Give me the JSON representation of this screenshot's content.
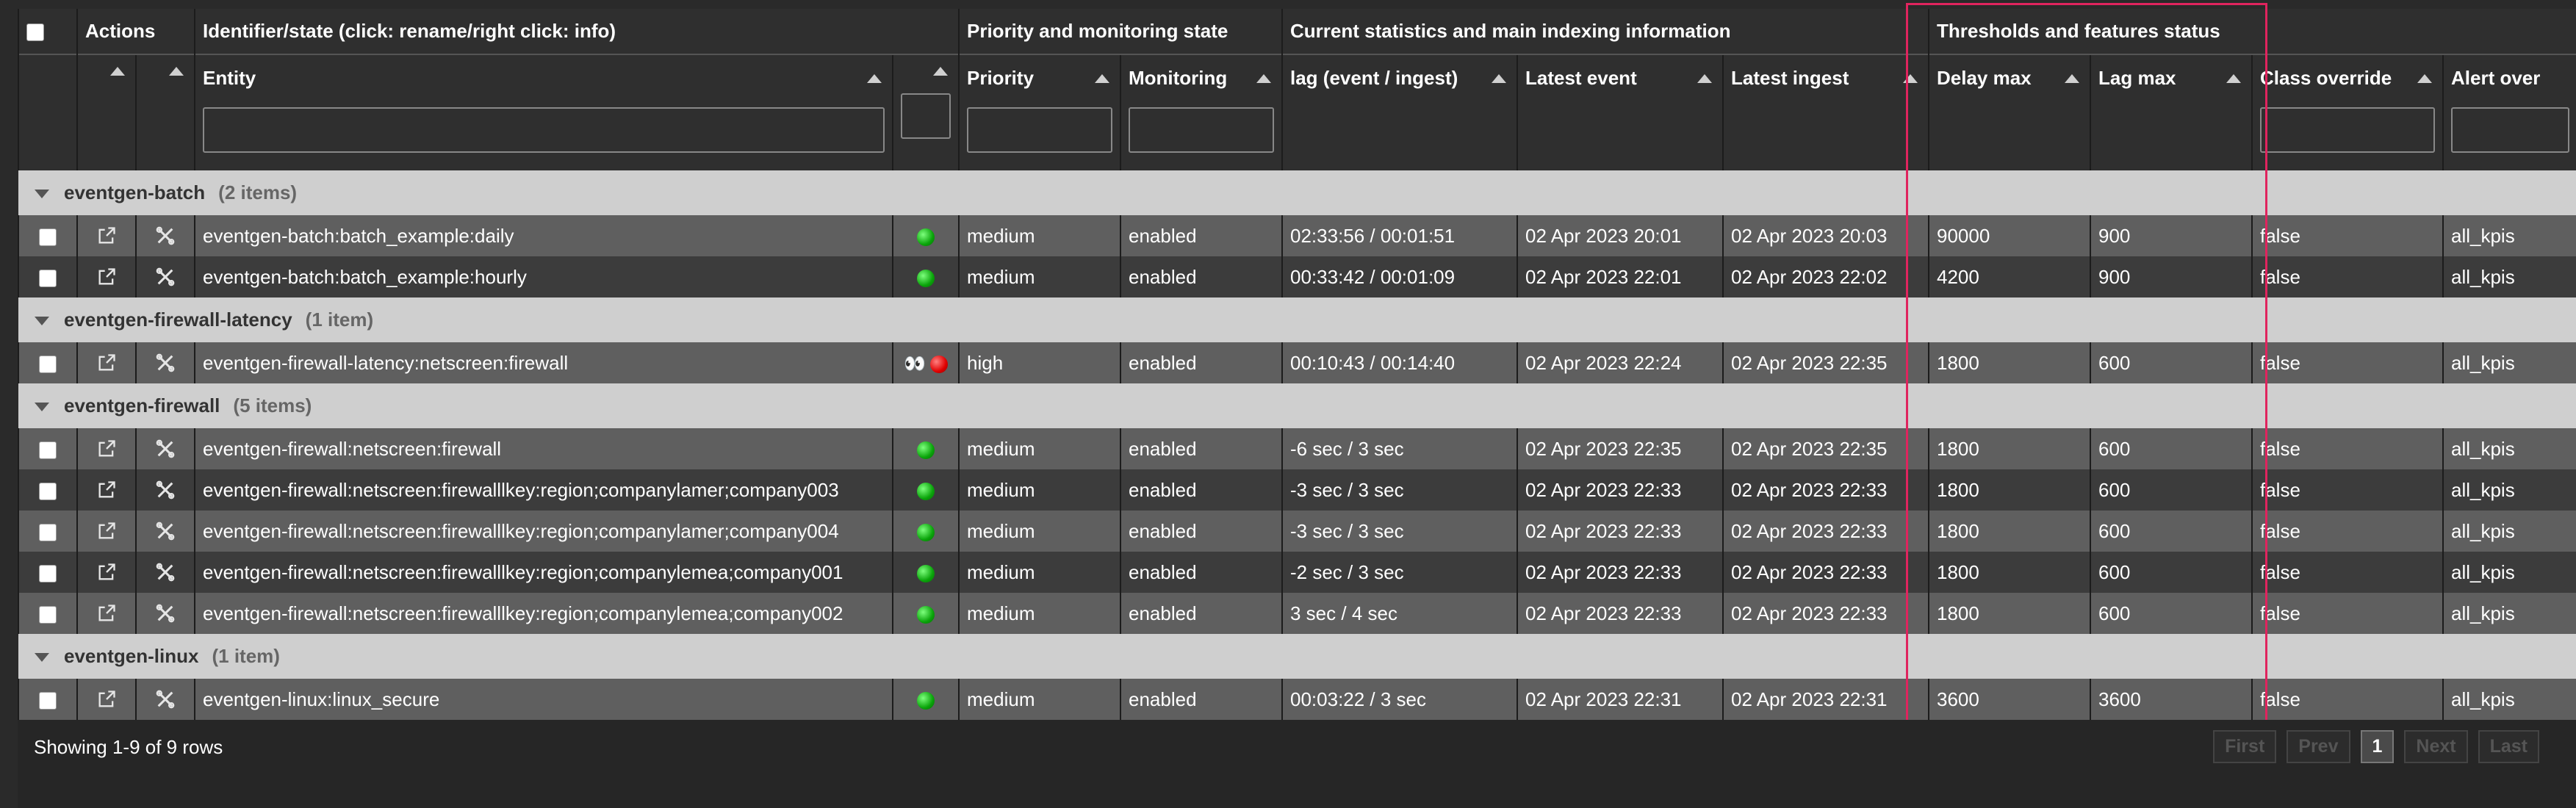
{
  "header": {
    "groups": {
      "actions": "Actions",
      "identifier": "Identifier/state (click: rename/right click: info)",
      "priority": "Priority and monitoring state",
      "stats": "Current statistics and main indexing information",
      "thresholds": "Thresholds and features status"
    },
    "columns": {
      "entity": "Entity",
      "priority": "Priority",
      "monitoring": "Monitoring",
      "lag": "lag (event / ingest)",
      "latest_event": "Latest event",
      "latest_ingest": "Latest ingest",
      "delay_max": "Delay max",
      "lag_max": "Lag max",
      "class_override": "Class override",
      "alert_over": "Alert over"
    }
  },
  "groups": [
    {
      "name": "eventgen-batch",
      "count": "(2 items)",
      "rows": [
        {
          "entity": "eventgen-batch:batch_example:daily",
          "state": "green",
          "eyes": false,
          "priority": "medium",
          "monitoring": "enabled",
          "lag": "02:33:56 / 00:01:51",
          "latest_event": "02 Apr 2023 20:01",
          "latest_ingest": "02 Apr 2023 20:03",
          "delay_max": "90000",
          "lag_max": "900",
          "class_override": "false",
          "alert_over": "all_kpis"
        },
        {
          "entity": "eventgen-batch:batch_example:hourly",
          "state": "green",
          "eyes": false,
          "priority": "medium",
          "monitoring": "enabled",
          "lag": "00:33:42 / 00:01:09",
          "latest_event": "02 Apr 2023 22:01",
          "latest_ingest": "02 Apr 2023 22:02",
          "delay_max": "4200",
          "lag_max": "900",
          "class_override": "false",
          "alert_over": "all_kpis"
        }
      ]
    },
    {
      "name": "eventgen-firewall-latency",
      "count": "(1 item)",
      "rows": [
        {
          "entity": "eventgen-firewall-latency:netscreen:firewall",
          "state": "red",
          "eyes": true,
          "priority": "high",
          "monitoring": "enabled",
          "lag": "00:10:43 / 00:14:40",
          "latest_event": "02 Apr 2023 22:24",
          "latest_ingest": "02 Apr 2023 22:35",
          "delay_max": "1800",
          "lag_max": "600",
          "class_override": "false",
          "alert_over": "all_kpis"
        }
      ]
    },
    {
      "name": "eventgen-firewall",
      "count": "(5 items)",
      "rows": [
        {
          "entity": "eventgen-firewall:netscreen:firewall",
          "state": "green",
          "eyes": false,
          "priority": "medium",
          "monitoring": "enabled",
          "lag": "-6 sec / 3 sec",
          "latest_event": "02 Apr 2023 22:35",
          "latest_ingest": "02 Apr 2023 22:35",
          "delay_max": "1800",
          "lag_max": "600",
          "class_override": "false",
          "alert_over": "all_kpis"
        },
        {
          "entity": "eventgen-firewall:netscreen:firewalllkey:region;companylamer;company003",
          "state": "green",
          "eyes": false,
          "priority": "medium",
          "monitoring": "enabled",
          "lag": "-3 sec / 3 sec",
          "latest_event": "02 Apr 2023 22:33",
          "latest_ingest": "02 Apr 2023 22:33",
          "delay_max": "1800",
          "lag_max": "600",
          "class_override": "false",
          "alert_over": "all_kpis"
        },
        {
          "entity": "eventgen-firewall:netscreen:firewalllkey:region;companylamer;company004",
          "state": "green",
          "eyes": false,
          "priority": "medium",
          "monitoring": "enabled",
          "lag": "-3 sec / 3 sec",
          "latest_event": "02 Apr 2023 22:33",
          "latest_ingest": "02 Apr 2023 22:33",
          "delay_max": "1800",
          "lag_max": "600",
          "class_override": "false",
          "alert_over": "all_kpis"
        },
        {
          "entity": "eventgen-firewall:netscreen:firewalllkey:region;companylemea;company001",
          "state": "green",
          "eyes": false,
          "priority": "medium",
          "monitoring": "enabled",
          "lag": "-2 sec / 3 sec",
          "latest_event": "02 Apr 2023 22:33",
          "latest_ingest": "02 Apr 2023 22:33",
          "delay_max": "1800",
          "lag_max": "600",
          "class_override": "false",
          "alert_over": "all_kpis"
        },
        {
          "entity": "eventgen-firewall:netscreen:firewalllkey:region;companylemea;company002",
          "state": "green",
          "eyes": false,
          "priority": "medium",
          "monitoring": "enabled",
          "lag": "3 sec / 4 sec",
          "latest_event": "02 Apr 2023 22:33",
          "latest_ingest": "02 Apr 2023 22:33",
          "delay_max": "1800",
          "lag_max": "600",
          "class_override": "false",
          "alert_over": "all_kpis"
        }
      ]
    },
    {
      "name": "eventgen-linux",
      "count": "(1 item)",
      "rows": [
        {
          "entity": "eventgen-linux:linux_secure",
          "state": "green",
          "eyes": false,
          "priority": "medium",
          "monitoring": "enabled",
          "lag": "00:03:22 / 3 sec",
          "latest_event": "02 Apr 2023 22:31",
          "latest_ingest": "02 Apr 2023 22:31",
          "delay_max": "3600",
          "lag_max": "3600",
          "class_override": "false",
          "alert_over": "all_kpis"
        }
      ]
    }
  ],
  "footer": {
    "showing": "Showing 1-9 of 9 rows",
    "pager": {
      "first": "First",
      "prev": "Prev",
      "page": "1",
      "next": "Next",
      "last": "Last"
    }
  },
  "colors": {
    "highlight": "#e0245e",
    "group_bg": "#cfcfcf",
    "row_odd": "#5f5f5f",
    "row_even": "#3c3c3c"
  }
}
